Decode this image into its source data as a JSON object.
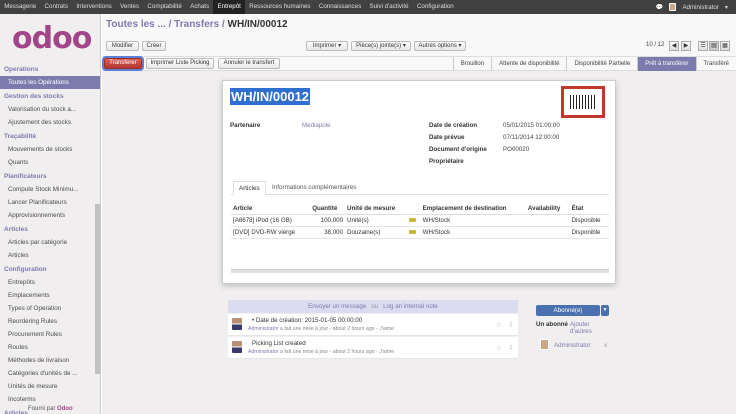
{
  "topbar": {
    "menu": [
      "Messagerie",
      "Contrats",
      "Interventions",
      "Ventes",
      "Comptabilité",
      "Achats",
      "Entrepôt",
      "Ressources humaines",
      "Connaissances",
      "Suivi d'activité",
      "Configuration"
    ],
    "active_menu": "Entrepôt",
    "user": "Administrator"
  },
  "sidebar": {
    "logo": "odoo",
    "sections": [
      {
        "title": "Operations",
        "items": [
          "Toutes les Opérations"
        ]
      },
      {
        "title": "Gestion des stocks",
        "items": [
          "Valorisation du stock a...",
          "Ajustement des stocks"
        ]
      },
      {
        "title": "Traçabilité",
        "items": [
          "Mouvements de stocks",
          "Quants"
        ]
      },
      {
        "title": "Planificateurs",
        "items": [
          "Compute Stock Minimu...",
          "Lancer Planificateurs",
          "Approvisionnements"
        ]
      },
      {
        "title": "Articles",
        "items": [
          "Articles par catégorie",
          "Articles"
        ]
      },
      {
        "title": "Configuration",
        "items": [
          "Entrepôts",
          "Emplacements",
          "Types of Operation",
          "Reordering Rules",
          "Procurement Rules",
          "Routes",
          "Méthodes de livraison",
          "Catégories d'unités de ...",
          "Unités de mesure",
          "Incoterms"
        ]
      },
      {
        "title": "Articles",
        "items": []
      }
    ],
    "footer_prefix": "Fourni par",
    "footer_brand": "Odoo"
  },
  "control": {
    "breadcrumb_root": "Toutes les ...",
    "breadcrumb_mid": "/ Transfers /",
    "breadcrumb_current": "WH/IN/00012",
    "edit": "Modifier",
    "create": "Créer",
    "print": "Imprimer ▾",
    "attachments": "Pièce(s) jointe(s) ▾",
    "more": "Autres options ▾",
    "pager": "10 / 12"
  },
  "statusbar": {
    "transfer": "Transferer",
    "print_picking": "Imprimer Liste Picking",
    "cancel": "Annuler le transfert",
    "steps": [
      "Brouillon",
      "Attente de disponibilité",
      "Disponibilité Partielle",
      "Prêt à transférer",
      "Transféré"
    ],
    "active_step": "Prêt à transférer"
  },
  "form": {
    "name": "WH/IN/00012",
    "partner_label": "Partenaire",
    "partner": "Mediapole",
    "date_label": "Date de création",
    "date": "05/01/2015 01:00:00",
    "planned_label": "Date prévue",
    "planned": "07/11/2014 12:00:00",
    "origin_label": "Document d'origine",
    "origin": "PO00020",
    "owner_label": "Propriétaire",
    "tabs": [
      "Articles",
      "Informations complémentaires"
    ],
    "columns": [
      "Article",
      "Quantité",
      "Unité de mesure",
      "",
      "Emplacement de destination",
      "Availability",
      "État"
    ],
    "rows": [
      [
        "[A6678] iPod (16 GB)",
        "100,000",
        "Unité(s)",
        "truck",
        "WH/Stock",
        "",
        "Disponible"
      ],
      [
        "[DVD] DVD-RW vierge",
        "38,000",
        "Douzaine(s)",
        "truck",
        "WH/Stock",
        "",
        "Disponible"
      ]
    ]
  },
  "chatter": {
    "send_message": "Envoyer un message",
    "or": "ou",
    "log_note": "Log an internal note",
    "messages": [
      {
        "text": "• Date de création: 2015-01-05 00:00:00",
        "author": "Administrator",
        "meta": " a fait une mise à jour - about 2 hours ago - J'aime"
      },
      {
        "text": "Picking List created",
        "author": "Administrator",
        "meta": " a fait une mise à jour - about 2 hours ago - J'aime"
      }
    ]
  },
  "followers": {
    "subscribed": "Abonné(e)",
    "one_follower": "Un abonné",
    "add_others": "Ajouter d'autres",
    "follower": "Administrator",
    "remove": "x"
  },
  "colors": {
    "accent": "#7c7bad",
    "brand": "#a24689",
    "primary": "#b33630",
    "topbar": "#414141"
  }
}
